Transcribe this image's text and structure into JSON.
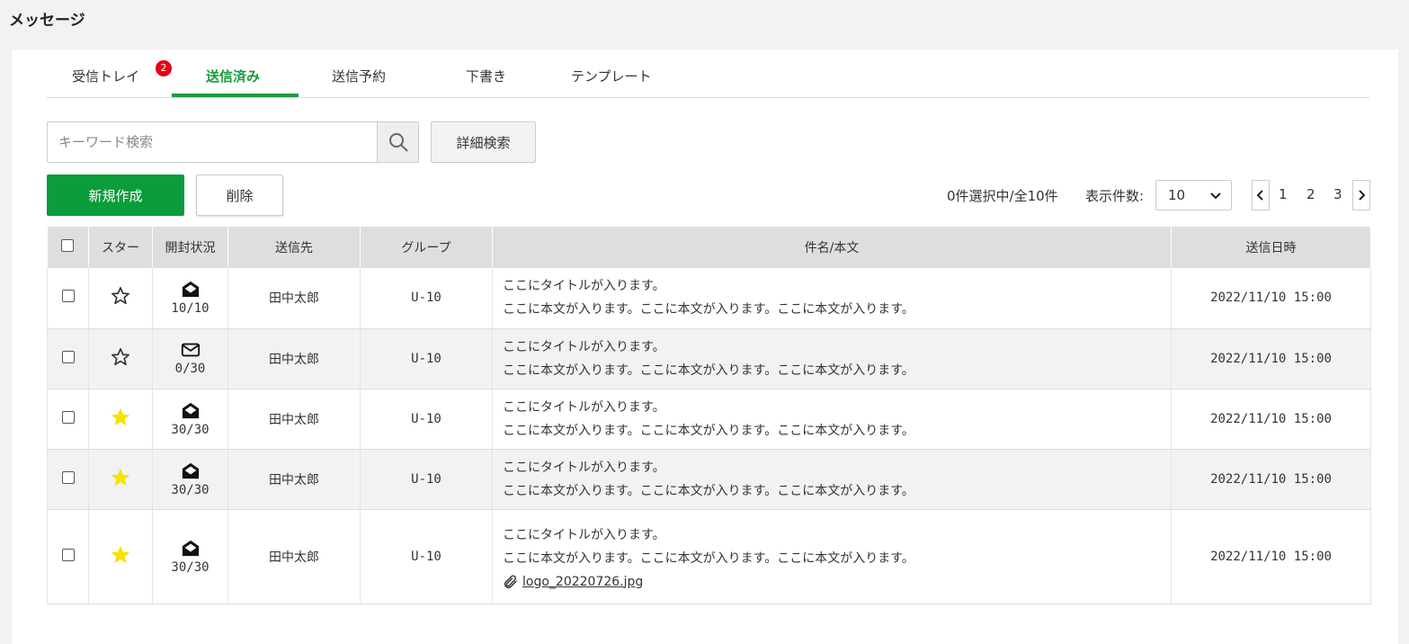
{
  "page": {
    "title": "メッセージ"
  },
  "tabs": [
    {
      "label": "受信トレイ",
      "badge": "2"
    },
    {
      "label": "送信済み",
      "active": true
    },
    {
      "label": "送信予約"
    },
    {
      "label": "下書き"
    },
    {
      "label": "テンプレート"
    }
  ],
  "search": {
    "placeholder": "キーワード検索",
    "advanced_label": "詳細検索"
  },
  "actions": {
    "new_label": "新規作成",
    "delete_label": "削除"
  },
  "list_info": {
    "selection": "0件選択中/全10件",
    "per_page_label": "表示件数:",
    "per_page_value": "10"
  },
  "pager": {
    "pages": [
      "1",
      "2",
      "3"
    ]
  },
  "table": {
    "headers": {
      "star": "スター",
      "open_status": "開封状況",
      "recipient": "送信先",
      "group": "グループ",
      "subject": "件名/本文",
      "sent_at": "送信日時"
    },
    "rows": [
      {
        "starred": false,
        "opened": true,
        "open_count": "10/10",
        "recipient": "田中太郎",
        "group": "U-10",
        "title": "ここにタイトルが入ります。",
        "body": "ここに本文が入ります。ここに本文が入ります。ここに本文が入ります。",
        "sent_at": "2022/11/10 15:00"
      },
      {
        "starred": false,
        "opened": false,
        "open_count": "0/30",
        "recipient": "田中太郎",
        "group": "U-10",
        "title": "ここにタイトルが入ります。",
        "body": "ここに本文が入ります。ここに本文が入ります。ここに本文が入ります。",
        "sent_at": "2022/11/10 15:00"
      },
      {
        "starred": true,
        "opened": true,
        "open_count": "30/30",
        "recipient": "田中太郎",
        "group": "U-10",
        "title": "ここにタイトルが入ります。",
        "body": "ここに本文が入ります。ここに本文が入ります。ここに本文が入ります。",
        "sent_at": "2022/11/10 15:00"
      },
      {
        "starred": true,
        "opened": true,
        "open_count": "30/30",
        "recipient": "田中太郎",
        "group": "U-10",
        "title": "ここにタイトルが入ります。",
        "body": "ここに本文が入ります。ここに本文が入ります。ここに本文が入ります。",
        "sent_at": "2022/11/10 15:00"
      },
      {
        "starred": true,
        "opened": true,
        "open_count": "30/30",
        "recipient": "田中太郎",
        "group": "U-10",
        "title": "ここにタイトルが入ります。",
        "body": "ここに本文が入ります。ここに本文が入ります。ここに本文が入ります。",
        "attachment": "logo_20220726.jpg",
        "sent_at": "2022/11/10 15:00"
      }
    ]
  },
  "colors": {
    "accent_green": "#0b9c3c",
    "tab_active": "#1a9c3e",
    "badge_red": "#e50012",
    "star_yellow": "#f5e400"
  },
  "icons": {
    "search": "search-icon",
    "star_empty": "star-outline-icon",
    "star_filled": "star-filled-icon",
    "opened": "envelope-open-icon",
    "unopened": "envelope-closed-icon",
    "attachment": "paperclip-icon"
  }
}
